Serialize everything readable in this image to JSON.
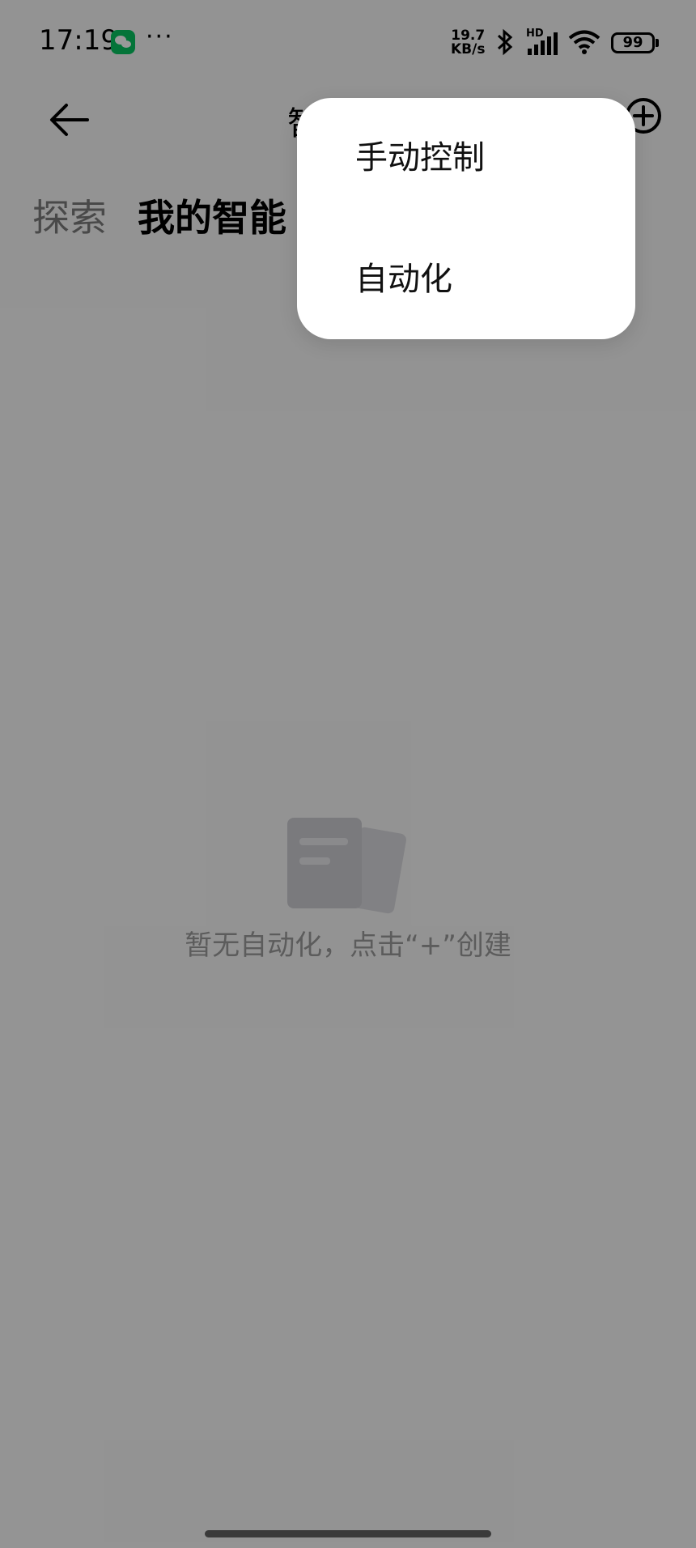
{
  "status_bar": {
    "time": "17:19",
    "more": "···",
    "net_speed_value": "19.7",
    "net_speed_unit": "KB/s",
    "hd_label": "HD",
    "battery": "99",
    "icons": [
      "wechat-icon",
      "bluetooth-icon",
      "signal-icon",
      "wifi-icon",
      "battery-icon"
    ]
  },
  "header": {
    "title": "智",
    "back_icon": "arrow-left-icon",
    "add_icon": "plus-circle-icon"
  },
  "tabs": [
    {
      "label": "探索",
      "active": false
    },
    {
      "label": "我的智能",
      "active": true
    }
  ],
  "empty_state": {
    "icon": "document-stack-icon",
    "text": "暂无自动化，点击“+”创建"
  },
  "popup_menu": {
    "items": [
      {
        "label": "手动控制"
      },
      {
        "label": "自动化"
      }
    ]
  },
  "colors": {
    "scrim": "rgba(0,0,0,0.40)",
    "menu_bg": "#ffffff",
    "wechat": "#07c160"
  }
}
